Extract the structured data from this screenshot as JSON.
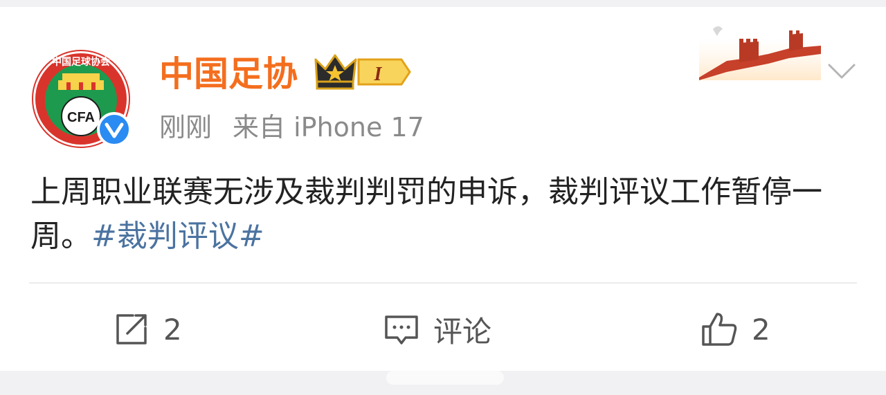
{
  "post": {
    "avatar_text": "CFA",
    "avatar_ring_text": "中国足球协会",
    "username": "中国足协",
    "vip_level": "I",
    "time": "刚刚",
    "source": "来自 iPhone 17",
    "text": "上周职业联赛无涉及裁判判罚的申诉，裁判评议工作暂停一周。",
    "hashtag": "#裁判评议#"
  },
  "actions": {
    "repost_count": "2",
    "comment_label": "评论",
    "like_count": "2"
  },
  "colors": {
    "username": "#f46e1e",
    "hashtag": "#4b73a0",
    "verified": "#2a8bf2",
    "avatar_ring": "#d9342b",
    "avatar_green": "#1d9a4e"
  },
  "icons": {
    "verified": "verified-v-icon",
    "vip": "crown-vip-icon",
    "more": "chevron-down-icon",
    "repost": "repost-icon",
    "comment": "comment-icon",
    "like": "thumbs-up-icon"
  }
}
